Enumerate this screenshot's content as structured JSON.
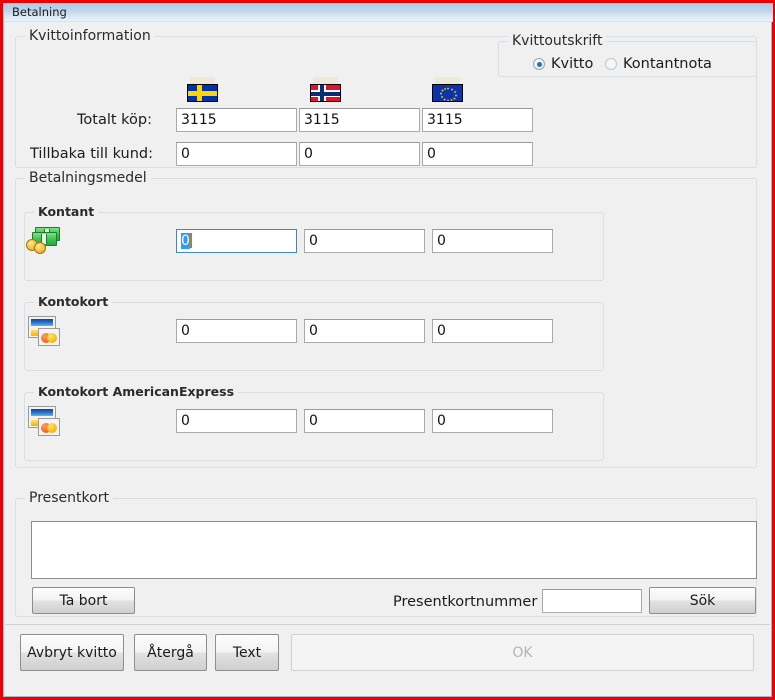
{
  "window": {
    "title": "Betalning",
    "border_color": "#ee0000",
    "background": "#f0f0f0"
  },
  "receipt_info": {
    "group_title": "Kvittoinformation",
    "currencies": [
      {
        "flag": "sweden-flag-icon",
        "name": "Sweden"
      },
      {
        "flag": "norway-flag-icon",
        "name": "Norway"
      },
      {
        "flag": "eu-flag-icon",
        "name": "European Union"
      }
    ],
    "rows": [
      {
        "label": "Totalt köp:",
        "values": [
          "3115",
          "3115",
          "3115"
        ]
      },
      {
        "label": "Tillbaka till kund:",
        "values": [
          "0",
          "0",
          "0"
        ]
      }
    ]
  },
  "receipt_print": {
    "group_title": "Kvittoutskrift",
    "options": [
      {
        "label": "Kvitto",
        "checked": true
      },
      {
        "label": "Kontantnota",
        "checked": false
      }
    ]
  },
  "payment_means": {
    "group_title": "Betalningsmedel",
    "methods": [
      {
        "title": "Kontant",
        "icon": "cash-money-icon",
        "values": [
          "0",
          "0",
          "0"
        ],
        "focused_index": 0,
        "focused_selected": true
      },
      {
        "title": "Kontokort",
        "icon": "credit-card-icon",
        "values": [
          "0",
          "0",
          "0"
        ],
        "focused_index": -1,
        "focused_selected": false
      },
      {
        "title": "Kontokort AmericanExpress",
        "icon": "credit-card-icon",
        "values": [
          "0",
          "0",
          "0"
        ],
        "focused_index": -1,
        "focused_selected": false
      }
    ]
  },
  "gift_card": {
    "group_title": "Presentkort",
    "list_items": [],
    "remove_button": "Ta bort",
    "number_label": "Presentkortnummer",
    "number_value": "",
    "search_button": "Sök"
  },
  "footer": {
    "cancel_receipt": "Avbryt kvitto",
    "back": "Återgå",
    "text": "Text",
    "ok": "OK",
    "ok_disabled": true
  },
  "colors": {
    "window_border": "#ee0000",
    "titlebar_start": "#b0cbe4",
    "titlebar_end": "#eaf2f9",
    "face": "#f0f0f0",
    "groupbox_border": "#d5dfe8",
    "focus_border": "#3f87c8",
    "selection": "#3399ff",
    "caret": "#c07820",
    "disabled_text": "#b4b4b4"
  }
}
